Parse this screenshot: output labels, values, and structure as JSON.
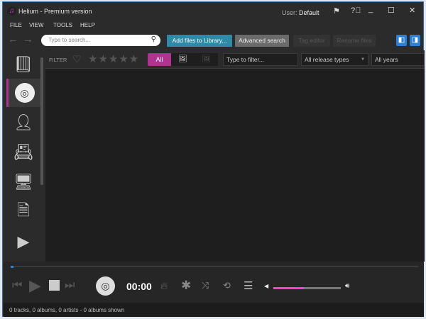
{
  "window": {
    "title": "Helium - Premium version",
    "user_label": "User:",
    "user_name": "Default"
  },
  "menu": [
    "FILE",
    "VIEW",
    "TOOLS",
    "HELP"
  ],
  "toolbar": {
    "search_placeholder": "Type to search...",
    "add_files": "Add files to Library...",
    "advanced_search": "Advanced search",
    "tag_editor": "Tag editor",
    "rename_files": "Rename files"
  },
  "filter": {
    "label": "FILTER",
    "rating_stars": 5,
    "all_label": "All",
    "filter_placeholder": "Type to filter...",
    "release_types": "All release types",
    "years": "All years"
  },
  "sidebar": {
    "items": [
      "library",
      "albums",
      "artists",
      "contacts",
      "monitor",
      "documents",
      "videos"
    ],
    "selected": "albums"
  },
  "player": {
    "time": "00:00",
    "progress": 0.005,
    "volume": 0.45
  },
  "status": "0 tracks, 0 albums, 0 artists - 0 albums shown",
  "colors": {
    "accent": "#b0338f",
    "volume": "#ff3fc9",
    "button_teal": "#2e8aa6",
    "panel_blue": "#2d7fd3"
  }
}
